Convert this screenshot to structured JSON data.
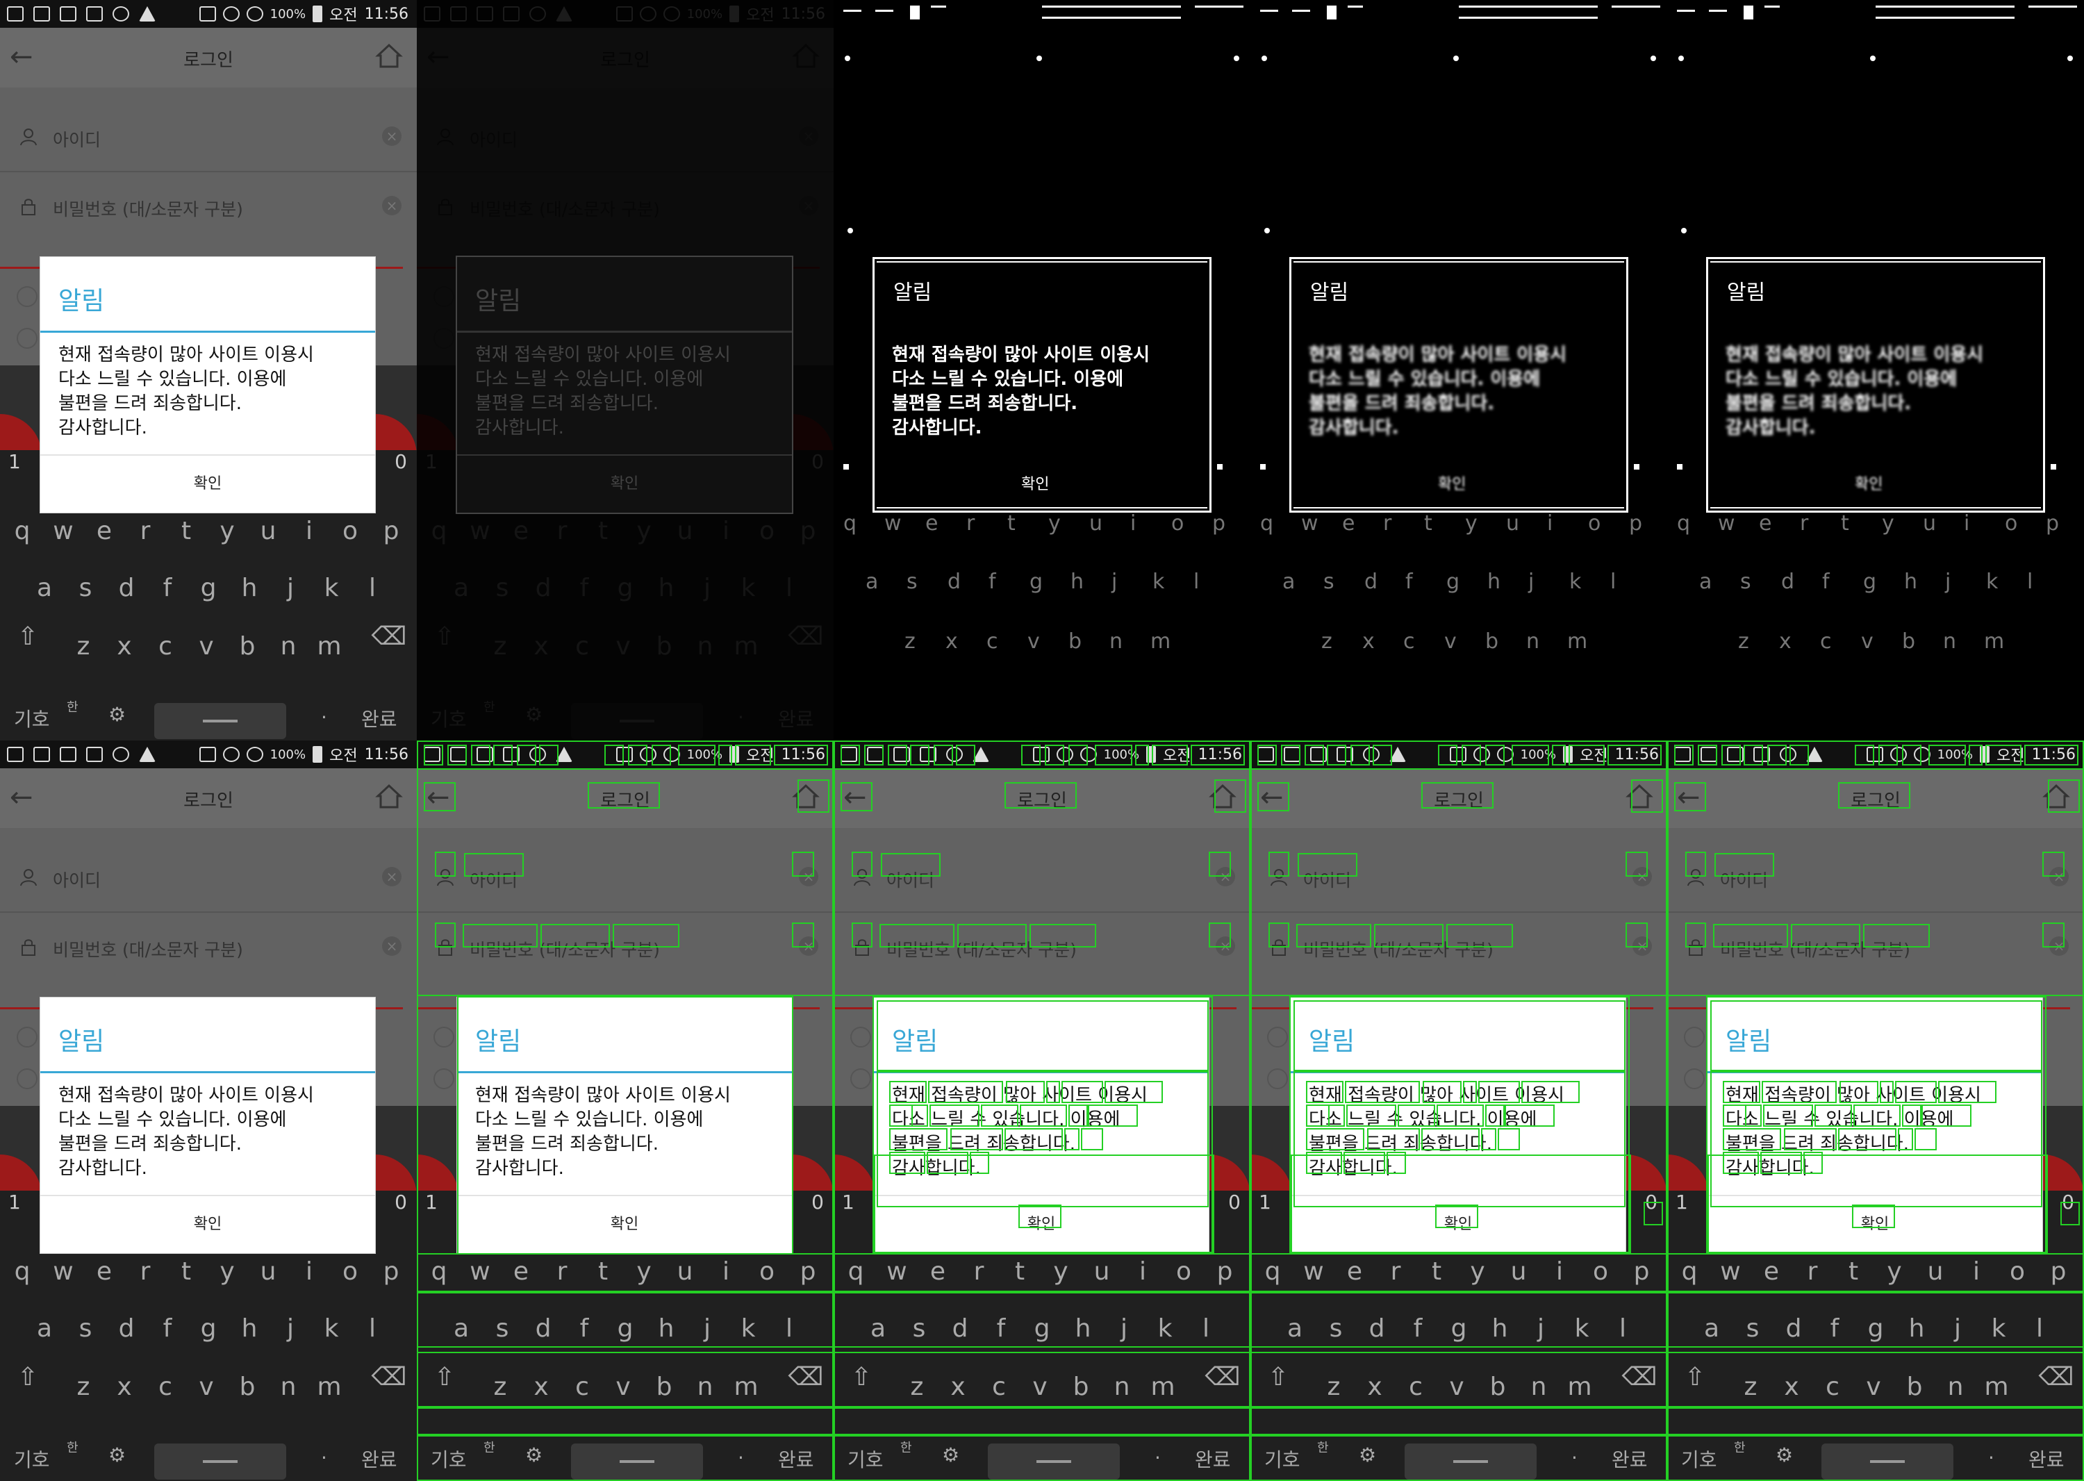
{
  "status_bar": {
    "battery_pct": "100%",
    "ampm": "오전",
    "time": "11:56"
  },
  "toolbar": {
    "title": "로그인"
  },
  "form": {
    "id_placeholder": "아이디",
    "password_placeholder": "비밀번호 (대/소문자 구분)"
  },
  "dialog": {
    "title": "알림",
    "message_lines": [
      "현재 접속량이 많아 사이트 이용시",
      "다소 느릴 수 있습니다. 이용에",
      "불편을 드려 죄송합니다.",
      "감사합니다."
    ],
    "confirm_label": "확인"
  },
  "keyboard": {
    "num_left": "1",
    "num_right": "0",
    "row1": [
      "q",
      "w",
      "e",
      "r",
      "t",
      "y",
      "u",
      "i",
      "o",
      "p"
    ],
    "row2": [
      "a",
      "s",
      "d",
      "f",
      "g",
      "h",
      "j",
      "k",
      "l"
    ],
    "row3": [
      "z",
      "x",
      "c",
      "v",
      "b",
      "n",
      "m"
    ],
    "symbols_label": "기호",
    "done_label": "완료",
    "period_label": "."
  },
  "colors": {
    "accent": "#38a7d6",
    "brand_red": "#9d1a1a",
    "overlay_box": "#24d024"
  },
  "icons": [
    "back-arrow-icon",
    "home-icon",
    "user-icon",
    "lock-icon",
    "clear-icon",
    "shift-icon",
    "backspace-icon",
    "settings-icon",
    "space-icon"
  ]
}
